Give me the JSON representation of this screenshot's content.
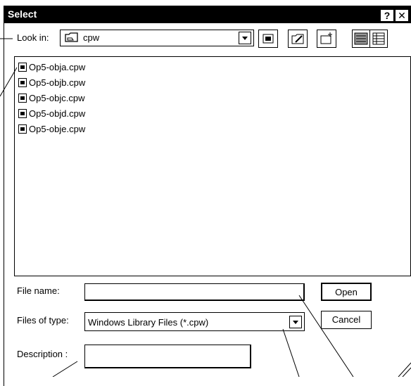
{
  "window": {
    "title": "Select",
    "help_glyph": "?",
    "close_glyph": "✕"
  },
  "look_in": {
    "label": "Look in:",
    "value": "cpw"
  },
  "toolbar": {
    "icons": [
      "up-one-level-icon",
      "new-folder-icon",
      "desktop-icon",
      "list-view-icon",
      "details-view-icon"
    ]
  },
  "files": [
    "Op5-obja.cpw",
    "Op5-objb.cpw",
    "Op5-objc.cpw",
    "Op5-objd.cpw",
    "Op5-obje.cpw"
  ],
  "file_name": {
    "label": "File name:",
    "value": ""
  },
  "files_of_type": {
    "label": "Files of type:",
    "value": "Windows Library Files (*.cpw)"
  },
  "description": {
    "label": "Description :",
    "value": ""
  },
  "buttons": {
    "open": "Open",
    "cancel": "Cancel"
  }
}
